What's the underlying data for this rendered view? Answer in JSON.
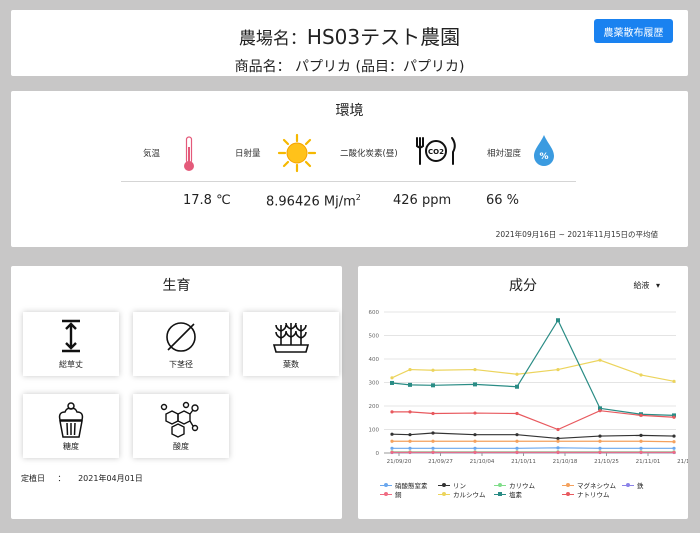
{
  "header": {
    "farm_label": "農場名：",
    "farm_name": "HS03テスト農園",
    "product_line": "商品名： パプリカ (品目：パプリカ)",
    "history_button": "農薬散布履歴"
  },
  "environment": {
    "title": "環境",
    "items": [
      {
        "label": "気温",
        "icon": "thermometer-icon",
        "value": "17.8 ℃"
      },
      {
        "label": "日射量",
        "icon": "sun-icon",
        "value": "8.96426 Mj/m",
        "sup": "2"
      },
      {
        "label": "二酸化炭素(昼)",
        "icon": "co2-dining-icon",
        "value": "426 ppm"
      },
      {
        "label": "相対湿度",
        "icon": "humidity-drop-icon",
        "value": "66 %",
        "icon_text": "%"
      }
    ],
    "period_note": "2021年09月16日 ~ 2021年11月15日の平均値"
  },
  "growth": {
    "title": "生育",
    "tiles": [
      {
        "label": "総草丈",
        "icon": "height-arrow-icon"
      },
      {
        "label": "下茎径",
        "icon": "diameter-icon"
      },
      {
        "label": "葉数",
        "icon": "leaves-icon"
      },
      {
        "label": "糖度",
        "icon": "cupcake-icon"
      },
      {
        "label": "酸度",
        "icon": "molecule-icon"
      }
    ],
    "planting_label": "定植日",
    "planting_sep": "：",
    "planting_date": "2021年04月01日"
  },
  "components": {
    "title": "成分",
    "select_value": "給液",
    "select_caret": "▾"
  },
  "chart_data": {
    "type": "line",
    "categories": [
      "21/09/20",
      "21/09/27",
      "21/10/04",
      "21/10/11",
      "21/10/18",
      "21/10/25",
      "21/11/01",
      "21/11/08"
    ],
    "x": [
      "21/09/20",
      "21/09/24",
      "21/10/01",
      "21/10/08",
      "21/10/15",
      "21/10/22",
      "21/10/29",
      "21/11/05",
      "21/11/12"
    ],
    "ylim": [
      0,
      600
    ],
    "yticks": [
      0,
      100,
      200,
      300,
      400,
      500,
      600
    ],
    "grid": true,
    "legend_position": "bottom",
    "series": [
      {
        "name": "硝酸態窒素",
        "color": "#6aa7ee",
        "marker": "circle",
        "values": [
          20,
          20,
          20,
          20,
          20,
          22,
          20,
          20,
          20
        ]
      },
      {
        "name": "リン",
        "color": "#333333",
        "marker": "circle",
        "values": [
          80,
          78,
          85,
          78,
          78,
          62,
          72,
          75,
          72
        ]
      },
      {
        "name": "カリウム",
        "color": "#80dd8a",
        "marker": "circle",
        "values": [
          5,
          5,
          5,
          5,
          5,
          5,
          5,
          5,
          5
        ]
      },
      {
        "name": "マグネシウム",
        "color": "#f4a15d",
        "marker": "circle",
        "values": [
          50,
          50,
          50,
          50,
          50,
          50,
          50,
          50,
          48
        ]
      },
      {
        "name": "鉄",
        "color": "#8a82e8",
        "marker": "circle",
        "values": [
          2,
          2,
          2,
          2,
          2,
          2,
          2,
          2,
          2
        ]
      },
      {
        "name": "銅",
        "color": "#f06b82",
        "marker": "circle",
        "values": [
          3,
          3,
          3,
          3,
          3,
          3,
          3,
          3,
          3
        ]
      },
      {
        "name": "カルシウム",
        "color": "#ecd45c",
        "marker": "circle",
        "values": [
          320,
          355,
          352,
          355,
          335,
          355,
          395,
          332,
          305
        ]
      },
      {
        "name": "塩素",
        "color": "#2a8c85",
        "marker": "square",
        "values": [
          298,
          290,
          288,
          292,
          282,
          565,
          190,
          165,
          160
        ]
      },
      {
        "name": "ナトリウム",
        "color": "#e8595e",
        "marker": "circle",
        "values": [
          175,
          175,
          168,
          170,
          168,
          100,
          180,
          160,
          152
        ]
      }
    ]
  }
}
